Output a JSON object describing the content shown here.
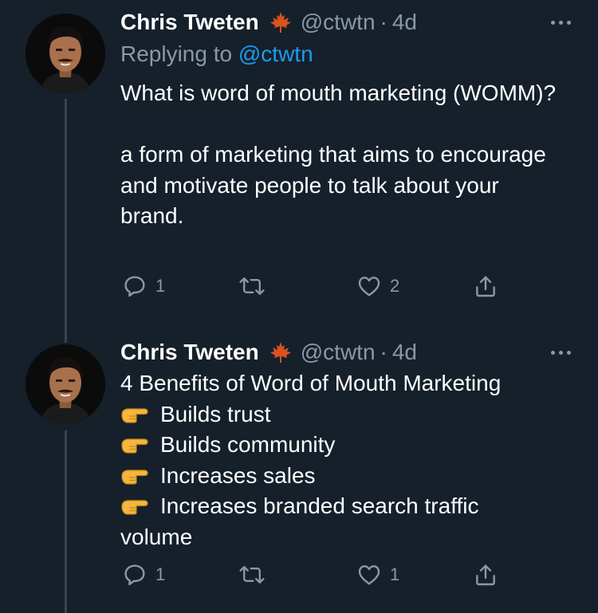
{
  "tweets": [
    {
      "author_name": "Chris Tweten",
      "handle": "@ctwtn",
      "separator": "·",
      "time": "4d",
      "replying_prefix": "Replying to",
      "replying_to": "@ctwtn",
      "paragraphs": [
        "What is word of mouth marketing (WOMM)?",
        "a form of marketing that aims to encourage and motivate people to talk about your brand."
      ],
      "counts": {
        "replies": "1",
        "retweets": "",
        "likes": "2"
      }
    },
    {
      "author_name": "Chris Tweten",
      "handle": "@ctwtn",
      "separator": "·",
      "time": "4d",
      "heading": "4 Benefits of Word of Mouth Marketing",
      "bullets": [
        "Builds trust",
        "Builds community",
        "Increases sales",
        "Increases branded search traffic"
      ],
      "trailing": "volume",
      "counts": {
        "replies": "1",
        "retweets": "",
        "likes": "1"
      }
    }
  ],
  "icons": {
    "name_badge": "maple-leaf-icon",
    "bullet": "pointing-hand-icon",
    "reply": "reply-icon",
    "retweet": "retweet-icon",
    "like": "heart-icon",
    "share": "share-icon",
    "menu": "more-icon"
  },
  "colors": {
    "background": "#15202b",
    "text": "#ffffff",
    "secondary": "#8b98a5",
    "link": "#1d9bf0",
    "thread_line": "#38444d",
    "leaf": "#d9531e"
  }
}
